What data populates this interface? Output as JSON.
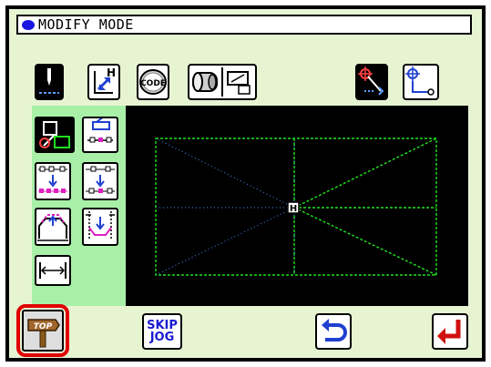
{
  "header": {
    "mode_title": "MODIFY MODE"
  },
  "toolbar": {
    "needle": "needle-position-icon",
    "home": {
      "letter": "H",
      "icon": "move-home-icon"
    },
    "code": {
      "label": "CODE",
      "icon": "code-icon"
    },
    "thread": "thread-spool-icon",
    "frame": "frame-view-icon",
    "pos_red": "jump-to-point-icon",
    "pos_blue": "move-to-point-icon"
  },
  "side_tools": [
    {
      "name": "modify-pattern-icon",
      "selected": true
    },
    {
      "name": "erase-point-icon",
      "selected": false
    },
    {
      "name": "insert-points-icon",
      "selected": false
    },
    {
      "name": "insert-single-point-icon",
      "selected": false
    },
    {
      "name": "move-section-icon",
      "selected": false
    },
    {
      "name": "shift-section-icon",
      "selected": false
    },
    {
      "name": "stitch-width-icon",
      "selected": false
    }
  ],
  "canvas": {
    "origin_marker": "H"
  },
  "bottom": {
    "top_label": "TOP",
    "skip_jog": [
      "SKIP",
      "JOG"
    ],
    "undo": "undo-arrow-icon",
    "enter": "enter-arrow-icon"
  },
  "colors": {
    "accent": "#1818e0",
    "stitch": "#20e020",
    "jump": "#4a8cff",
    "highlight": "#e00000"
  }
}
